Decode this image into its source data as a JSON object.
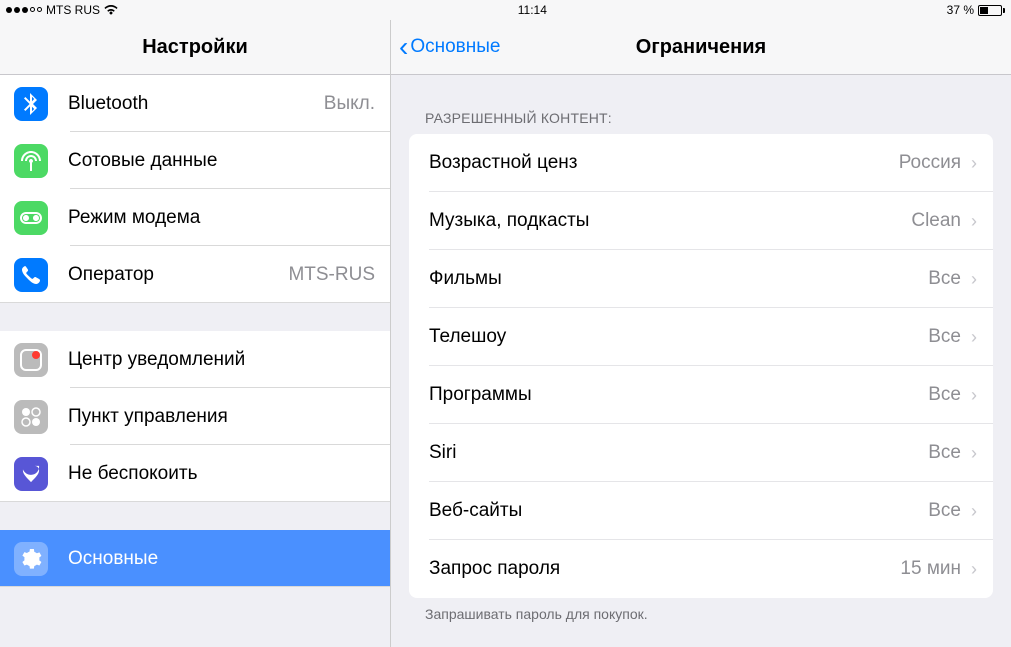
{
  "status": {
    "carrier": "MTS RUS",
    "time": "11:14",
    "battery_pct": "37 %"
  },
  "sidebar": {
    "title": "Настройки",
    "items": [
      {
        "label": "Bluetooth",
        "value": "Выкл."
      },
      {
        "label": "Сотовые данные",
        "value": ""
      },
      {
        "label": "Режим модема",
        "value": ""
      },
      {
        "label": "Оператор",
        "value": "MTS-RUS"
      }
    ],
    "items2": [
      {
        "label": "Центр уведомлений",
        "value": ""
      },
      {
        "label": "Пункт управления",
        "value": ""
      },
      {
        "label": "Не беспокоить",
        "value": ""
      }
    ],
    "items3": [
      {
        "label": "Основные",
        "value": ""
      }
    ]
  },
  "main": {
    "back": "Основные",
    "title": "Ограничения",
    "section_header": "РАЗРЕШЕННЫЙ КОНТЕНТ:",
    "rows": [
      {
        "label": "Возрастной ценз",
        "value": "Россия"
      },
      {
        "label": "Музыка, подкасты",
        "value": "Clean"
      },
      {
        "label": "Фильмы",
        "value": "Все"
      },
      {
        "label": "Телешоу",
        "value": "Все"
      },
      {
        "label": "Программы",
        "value": "Все"
      },
      {
        "label": "Siri",
        "value": "Все"
      },
      {
        "label": "Веб-сайты",
        "value": "Все"
      },
      {
        "label": "Запрос пароля",
        "value": "15 мин"
      }
    ],
    "footer": "Запрашивать пароль для покупок."
  }
}
